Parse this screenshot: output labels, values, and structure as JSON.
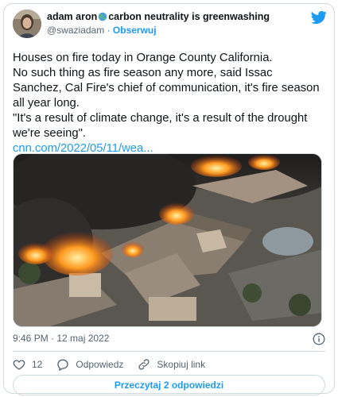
{
  "tweet": {
    "author": {
      "display_name": "adam aron",
      "display_name_suffix": "carbon neutrality is greenwashing",
      "handle": "@swaziadam",
      "separator": "·",
      "follow_label": "Obserwuj"
    },
    "text_lines": [
      "Houses on fire today in Orange County California.",
      "No such thing as fire season any more, said Issac Sanchez, Cal Fire's chief of communication, it's fire season all year long.",
      "\"It's a result of climate change, it's a result of the drought we're seeing\"."
    ],
    "link_text": "cnn.com/2022/05/11/wea...",
    "timestamp": "9:46 PM · 12 maj 2022",
    "likes_count": "12",
    "reply_label": "Odpowiedz",
    "copy_link_label": "Skopiuj link",
    "read_replies_label": "Przeczytaj 2 odpowiedzi"
  },
  "colors": {
    "accent": "#1d9bf0",
    "text": "#0f1419",
    "muted": "#536471",
    "border": "#cfd9de"
  },
  "icons": [
    "twitter-bird-icon",
    "globe-icon",
    "info-icon",
    "heart-icon",
    "reply-icon",
    "link-icon"
  ]
}
